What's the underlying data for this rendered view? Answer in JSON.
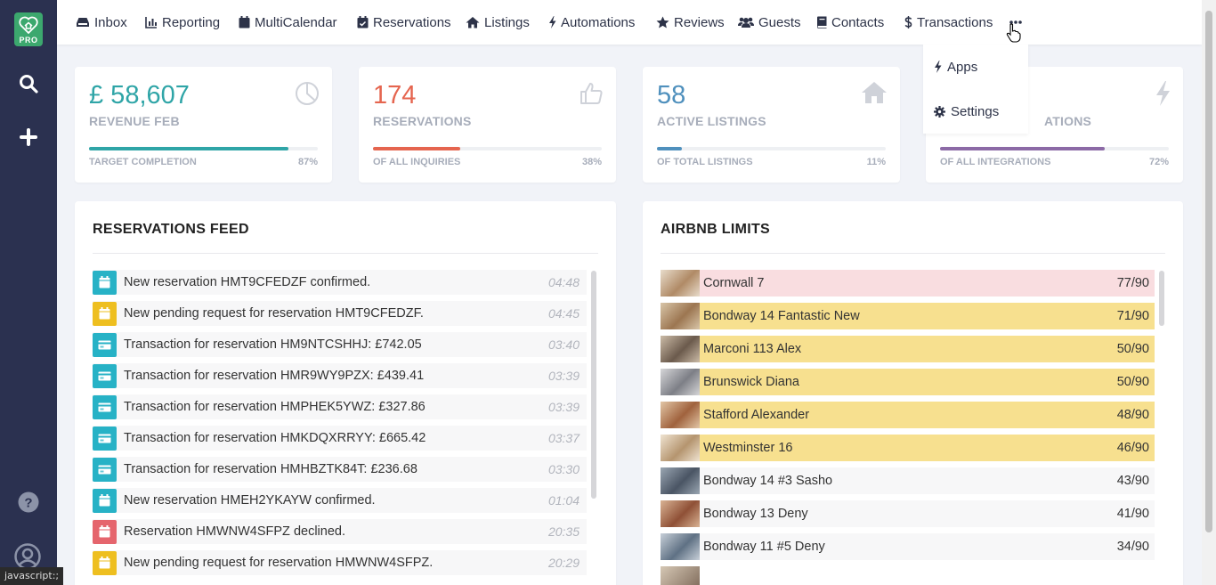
{
  "app": {
    "badge": "PRO"
  },
  "nav": {
    "items": [
      {
        "label": "Inbox",
        "icon": "inbox-icon"
      },
      {
        "label": "Reporting",
        "icon": "bar-chart-icon"
      },
      {
        "label": "MultiCalendar",
        "icon": "calendar-icon"
      },
      {
        "label": "Reservations",
        "icon": "calendar-check-icon"
      },
      {
        "label": "Listings",
        "icon": "home-icon"
      },
      {
        "label": "Automations",
        "icon": "bolt-icon"
      },
      {
        "label": "Reviews",
        "icon": "star-icon"
      },
      {
        "label": "Guests",
        "icon": "users-icon"
      },
      {
        "label": "Contacts",
        "icon": "book-icon"
      },
      {
        "label": "Transactions",
        "icon": "dollar-icon"
      }
    ],
    "dropdown": [
      {
        "label": "Apps",
        "icon": "bolt-icon"
      },
      {
        "label": "Settings",
        "icon": "gear-icon"
      }
    ]
  },
  "stats": [
    {
      "value": "£ 58,607",
      "label": "REVENUE FEB",
      "bar_label": "TARGET COMPLETION",
      "pct": "87%",
      "fill": 0.87,
      "color": "#2fa5a7",
      "icon": "pie-chart-icon"
    },
    {
      "value": "174",
      "label": "RESERVATIONS",
      "bar_label": "OF ALL INQUIRIES",
      "pct": "38%",
      "fill": 0.38,
      "color": "#e5654f",
      "icon": "thumbs-up-icon"
    },
    {
      "value": "58",
      "label": "ACTIVE LISTINGS",
      "bar_label": "OF TOTAL LISTINGS",
      "pct": "11%",
      "fill": 0.11,
      "color": "#4f90bd",
      "icon": "home-icon"
    },
    {
      "value": "",
      "label": "ATIONS",
      "bar_label": "OF ALL INTEGRATIONS",
      "pct": "72%",
      "fill": 0.72,
      "color": "#8c6aa6",
      "icon": "bolt-icon"
    }
  ],
  "feed": {
    "title": "RESERVATIONS FEED",
    "items": [
      {
        "text": "New reservation HMT9CFEDZF confirmed.",
        "time": "04:48",
        "type": "calendar",
        "color": "#27b2c6"
      },
      {
        "text": "New pending request for reservation HMT9CFEDZF.",
        "time": "04:45",
        "type": "calendar",
        "color": "#eebf20"
      },
      {
        "text": "Transaction for reservation HM9NTCSHHJ: £742.05",
        "time": "03:40",
        "type": "card",
        "color": "#27b2c6"
      },
      {
        "text": "Transaction for reservation HMR9WY9PZX: £439.41",
        "time": "03:39",
        "type": "card",
        "color": "#27b2c6"
      },
      {
        "text": "Transaction for reservation HMPHEK5YWZ: £327.86",
        "time": "03:39",
        "type": "card",
        "color": "#27b2c6"
      },
      {
        "text": "Transaction for reservation HMKDQXRRYY: £665.42",
        "time": "03:37",
        "type": "card",
        "color": "#27b2c6"
      },
      {
        "text": "Transaction for reservation HMHBZTK84T: £236.68",
        "time": "03:30",
        "type": "card",
        "color": "#27b2c6"
      },
      {
        "text": "New reservation HMEH2YKAYW confirmed.",
        "time": "01:04",
        "type": "calendar",
        "color": "#27b2c6"
      },
      {
        "text": "Reservation HMWNW4SFPZ declined.",
        "time": "20:35",
        "type": "calendar",
        "color": "#e5656d"
      },
      {
        "text": "New pending request for reservation HMWNW4SFPZ.",
        "time": "20:29",
        "type": "calendar",
        "color": "#eebf20"
      }
    ]
  },
  "limits": {
    "title": "AIRBNB LIMITS",
    "items": [
      {
        "name": "Cornwall 7",
        "count": "77/90",
        "bg": "#f9dde0"
      },
      {
        "name": "Bondway 14 Fantastic New",
        "count": "71/90",
        "bg": "#f7e08f"
      },
      {
        "name": "Marconi 113 Alex",
        "count": "50/90",
        "bg": "#f7e08f"
      },
      {
        "name": "Brunswick Diana",
        "count": "50/90",
        "bg": "#f7e08f"
      },
      {
        "name": "Stafford Alexander",
        "count": "48/90",
        "bg": "#f7e08f"
      },
      {
        "name": "Westminster 16",
        "count": "46/90",
        "bg": "#f7e08f"
      },
      {
        "name": "Bondway 14 #3 Sasho",
        "count": "43/90",
        "bg": "#f7f7f8"
      },
      {
        "name": "Bondway 13 Deny",
        "count": "41/90",
        "bg": "#f7f7f8"
      },
      {
        "name": "Bondway 11 #5 Deny",
        "count": "34/90",
        "bg": "#f7f7f8"
      }
    ]
  },
  "status_tip": "javascript:;"
}
